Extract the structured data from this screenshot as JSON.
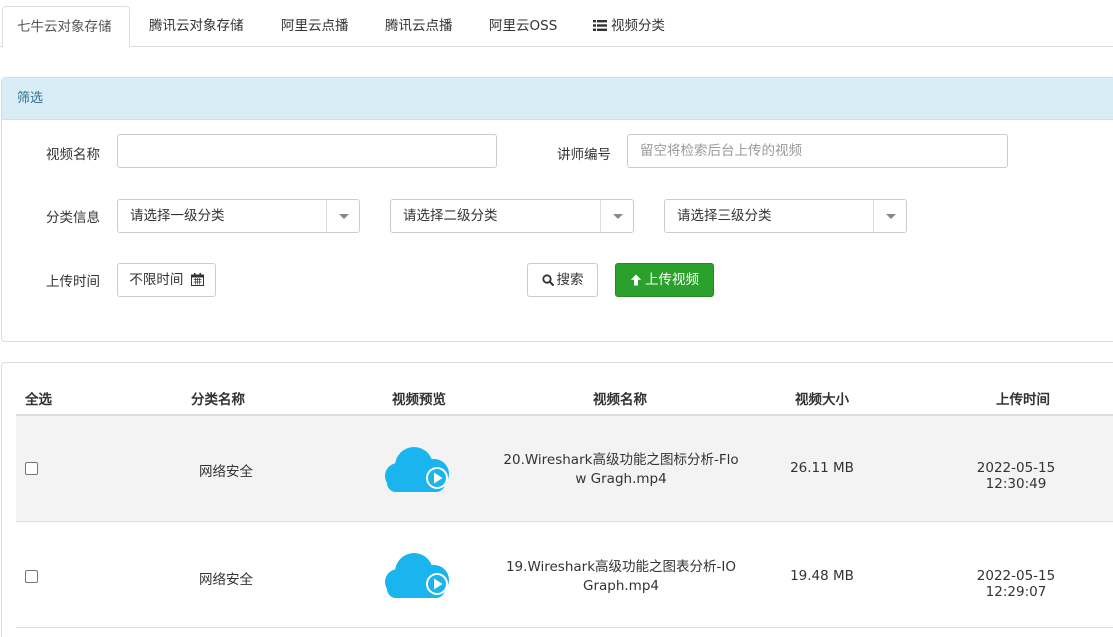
{
  "tabs": [
    {
      "label": "七牛云对象存储",
      "active": true
    },
    {
      "label": "腾讯云对象存储"
    },
    {
      "label": "阿里云点播"
    },
    {
      "label": "腾讯云点播"
    },
    {
      "label": "阿里云OSS"
    },
    {
      "label": "视频分类",
      "icon": "list-icon"
    }
  ],
  "filter": {
    "heading": "筛选",
    "video_name_label": "视频名称",
    "video_name_value": "",
    "lecturer_label": "讲师编号",
    "lecturer_placeholder": "留空将检索后台上传的视频",
    "category_label": "分类信息",
    "category1": "请选择一级分类",
    "category2": "请选择二级分类",
    "category3": "请选择三级分类",
    "upload_time_label": "上传时间",
    "upload_time_value": "不限时间",
    "search_button": "搜索",
    "upload_button": "上传视频"
  },
  "table": {
    "headers": [
      "全选",
      "分类名称",
      "视频预览",
      "视频名称",
      "视频大小",
      "上传时间"
    ],
    "rows": [
      {
        "category": "网络安全",
        "name_line1": "20.Wireshark高级功能之图标分析-Flo",
        "name_line2": "w Gragh.mp4",
        "size": "26.11 MB",
        "time": "2022-05-15 12:30:49"
      },
      {
        "category": "网络安全",
        "name_line1": "19.Wireshark高级功能之图表分析-IO",
        "name_line2": "Graph.mp4",
        "size": "19.48 MB",
        "time": "2022-05-15 12:29:07"
      }
    ]
  },
  "colors": {
    "panel_heading_bg": "#d9edf7",
    "panel_heading_text": "#31708f",
    "success": "#2ca02c",
    "cloud_icon": "#1ab4ee",
    "odd_row": "#f3f3f3"
  }
}
